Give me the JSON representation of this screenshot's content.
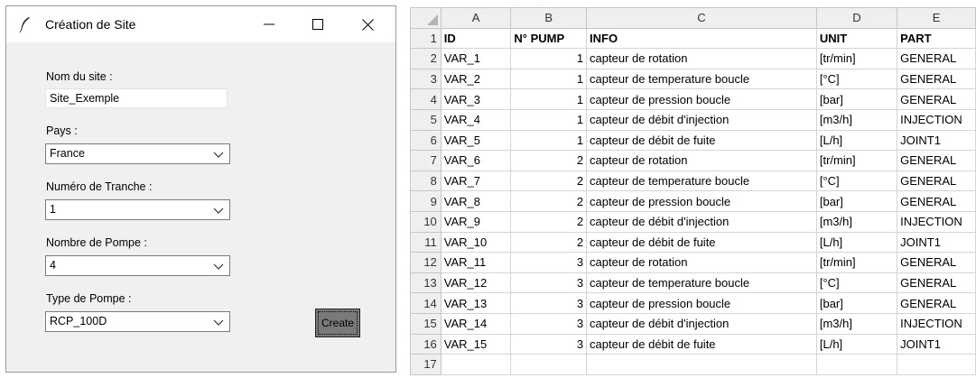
{
  "window": {
    "title": "Création de Site",
    "controls": {
      "minimize": "minimize-icon",
      "maximize": "maximize-icon",
      "close": "close-icon"
    }
  },
  "form": {
    "site_label": "Nom du site :",
    "site_value": "Site_Exemple",
    "pays_label": "Pays :",
    "pays_value": "France",
    "tranche_label": "Numéro de Tranche :",
    "tranche_value": "1",
    "pompe_nb_label": "Nombre de Pompe :",
    "pompe_nb_value": "4",
    "pompe_type_label": "Type de Pompe :",
    "pompe_type_value": "RCP_100D",
    "create_label": "Create"
  },
  "sheet": {
    "columns": [
      "A",
      "B",
      "C",
      "D",
      "E"
    ],
    "header_row": {
      "num": "1",
      "cells": [
        "ID",
        "N°  PUMP",
        "INFO",
        "UNIT",
        "PART"
      ]
    },
    "rows": [
      {
        "num": "2",
        "cells": [
          "VAR_1",
          "1",
          "capteur de rotation",
          "[tr/min]",
          "GENERAL"
        ]
      },
      {
        "num": "3",
        "cells": [
          "VAR_2",
          "1",
          "capteur de temperature boucle",
          "[°C]",
          "GENERAL"
        ]
      },
      {
        "num": "4",
        "cells": [
          "VAR_3",
          "1",
          "capteur de pression boucle",
          "[bar]",
          "GENERAL"
        ]
      },
      {
        "num": "5",
        "cells": [
          "VAR_4",
          "1",
          "capteur de débit d'injection",
          "[m3/h]",
          "INJECTION"
        ]
      },
      {
        "num": "6",
        "cells": [
          "VAR_5",
          "1",
          "capteur de débit de fuite",
          "[L/h]",
          "JOINT1"
        ]
      },
      {
        "num": "7",
        "cells": [
          "VAR_6",
          "2",
          "capteur de rotation",
          "[tr/min]",
          "GENERAL"
        ]
      },
      {
        "num": "8",
        "cells": [
          "VAR_7",
          "2",
          "capteur de temperature boucle",
          "[°C]",
          "GENERAL"
        ]
      },
      {
        "num": "9",
        "cells": [
          "VAR_8",
          "2",
          "capteur de pression boucle",
          "[bar]",
          "GENERAL"
        ]
      },
      {
        "num": "10",
        "cells": [
          "VAR_9",
          "2",
          "capteur de débit d'injection",
          "[m3/h]",
          "INJECTION"
        ]
      },
      {
        "num": "11",
        "cells": [
          "VAR_10",
          "2",
          "capteur de débit de fuite",
          "[L/h]",
          "JOINT1"
        ]
      },
      {
        "num": "12",
        "cells": [
          "VAR_11",
          "3",
          "capteur de rotation",
          "[tr/min]",
          "GENERAL"
        ]
      },
      {
        "num": "13",
        "cells": [
          "VAR_12",
          "3",
          "capteur de temperature boucle",
          "[°C]",
          "GENERAL"
        ]
      },
      {
        "num": "14",
        "cells": [
          "VAR_13",
          "3",
          "capteur de pression boucle",
          "[bar]",
          "GENERAL"
        ]
      },
      {
        "num": "15",
        "cells": [
          "VAR_14",
          "3",
          "capteur de débit d'injection",
          "[m3/h]",
          "INJECTION"
        ]
      },
      {
        "num": "16",
        "cells": [
          "VAR_15",
          "3",
          "capteur de débit de fuite",
          "[L/h]",
          "JOINT1"
        ]
      },
      {
        "num": "17",
        "cells": [
          "",
          "",
          "",
          "",
          ""
        ]
      }
    ]
  }
}
